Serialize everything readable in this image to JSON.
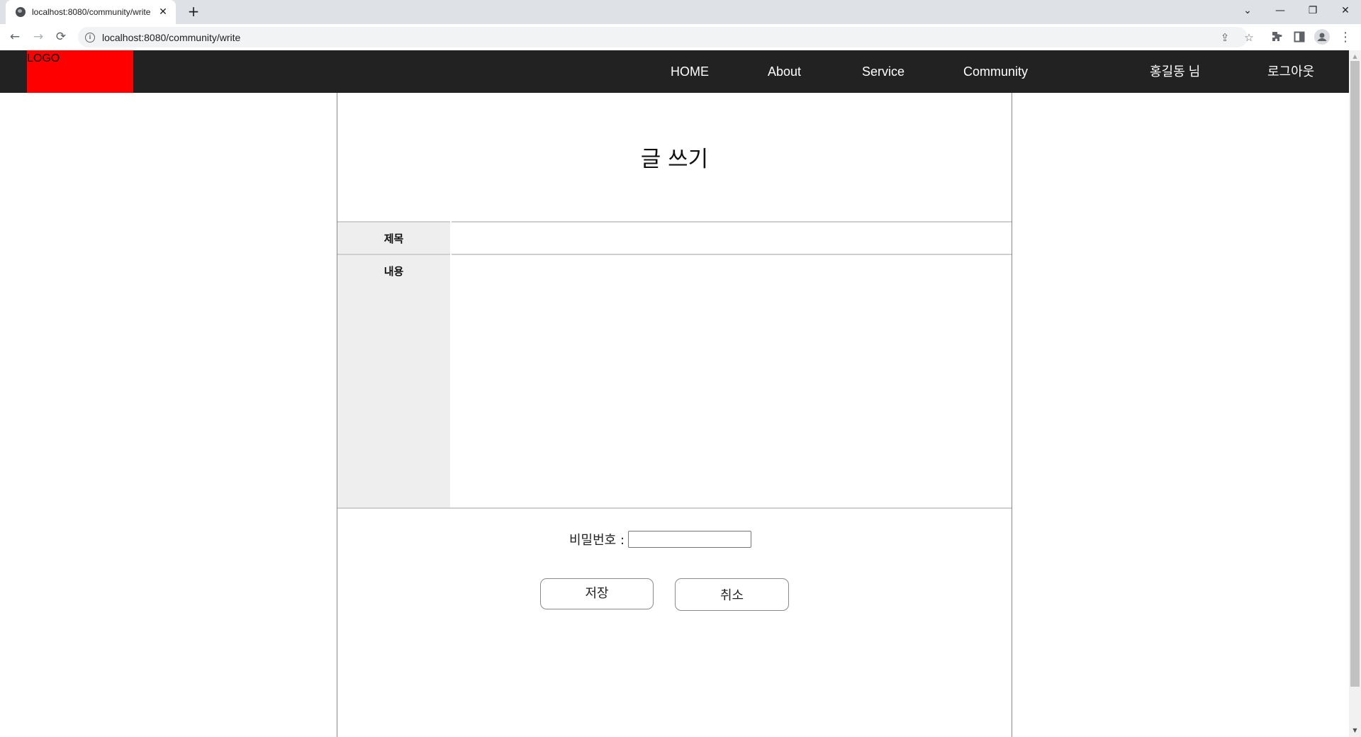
{
  "browser": {
    "tab_title": "localhost:8080/community/write",
    "tab_close": "✕",
    "new_tab": "+",
    "url": "localhost:8080/community/write",
    "window_controls": {
      "dropdown": "⌄",
      "minimize": "—",
      "restore": "❐",
      "close": "✕"
    },
    "nav": {
      "back": "←",
      "forward": "→",
      "reload": "⟳"
    },
    "icons": {
      "share": "⇪",
      "bookmark": "☆",
      "extensions": "✱",
      "side_panel": "▮",
      "profile": "●",
      "menu": "⋮"
    }
  },
  "header": {
    "logo": "LOGO",
    "nav_items": [
      "HOME",
      "About",
      "Service",
      "Community"
    ],
    "user_greeting": "홍길동 님",
    "logout": "로그아웃",
    "colors": {
      "bar": "#222222",
      "logo_bg": "#ff0000",
      "text": "#ffffff"
    }
  },
  "main": {
    "title": "글 쓰기",
    "fields": {
      "title_label": "제목",
      "title_value": "",
      "content_label": "내용",
      "content_value": ""
    },
    "password": {
      "label": "비밀번호 :",
      "value": ""
    },
    "buttons": {
      "save": "저장",
      "cancel": "취소"
    }
  },
  "scrollbar": {
    "up": "▲",
    "down": "▼"
  }
}
